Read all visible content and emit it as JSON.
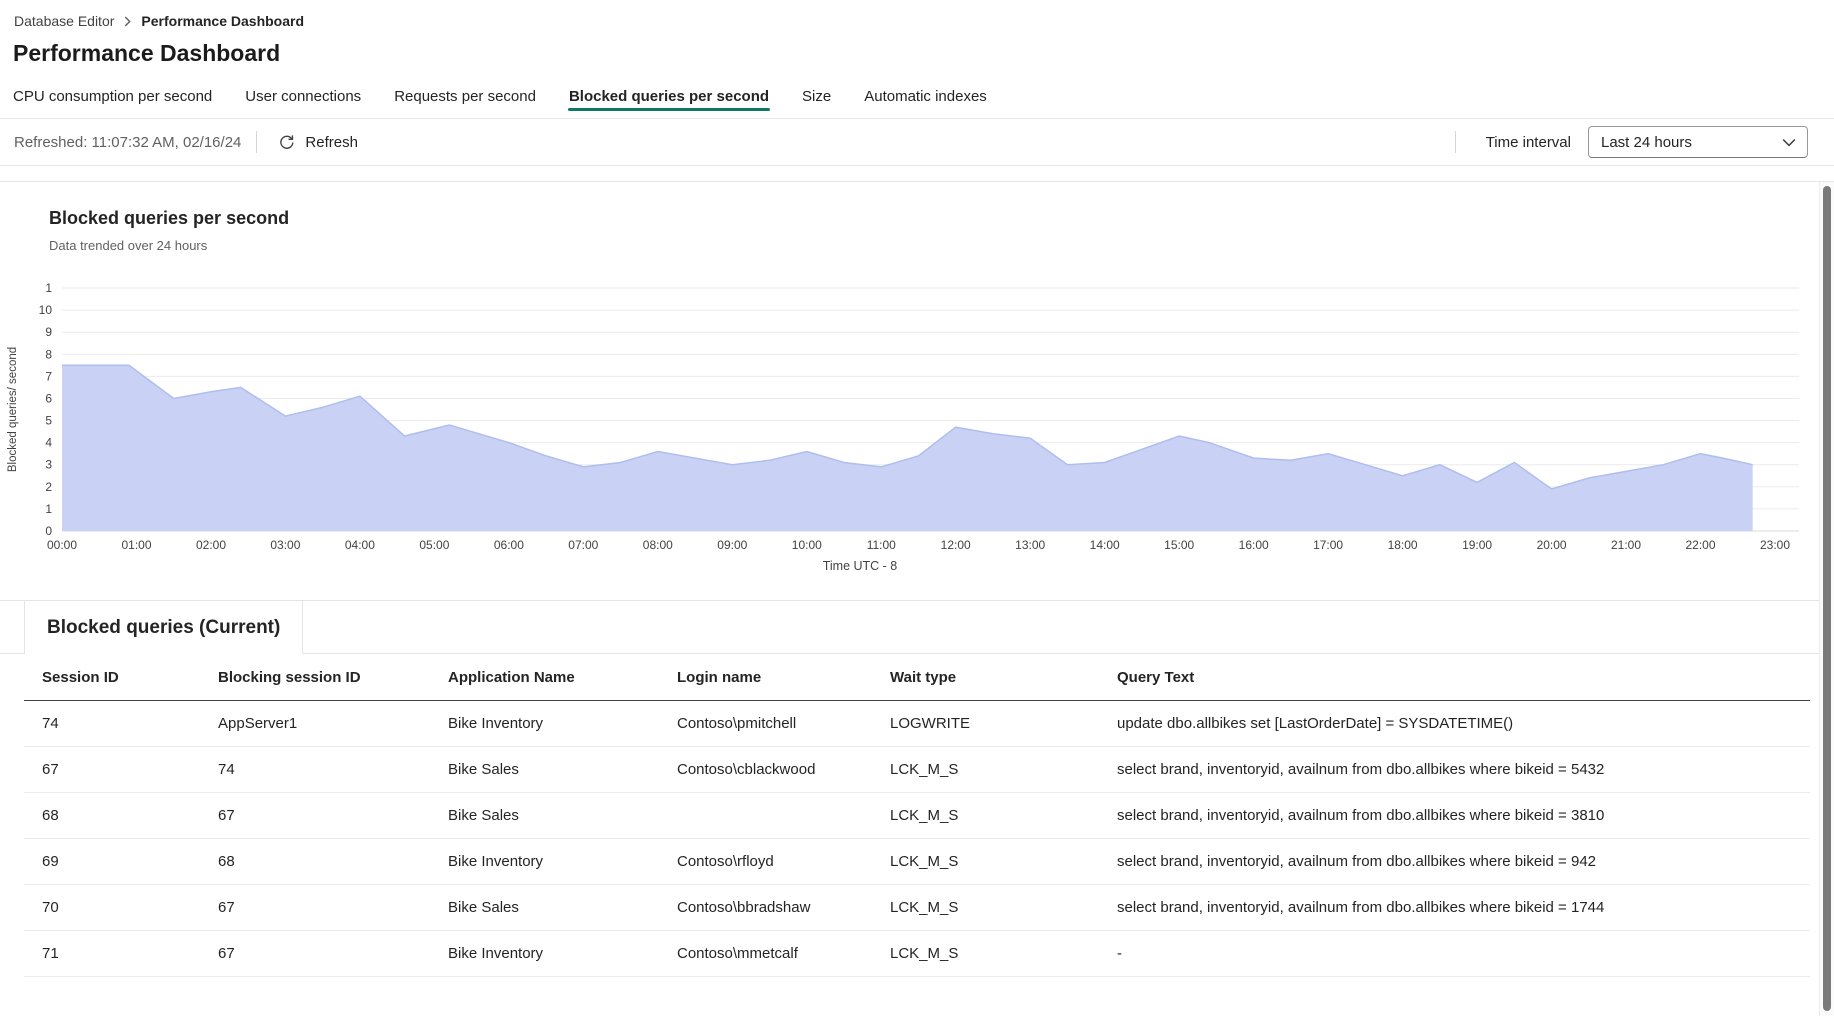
{
  "colors": {
    "accent": "#117865"
  },
  "breadcrumb": {
    "items": [
      "Database Editor",
      "Performance Dashboard"
    ]
  },
  "page": {
    "title": "Performance Dashboard"
  },
  "tabs": {
    "items": [
      {
        "label": "CPU consumption per second",
        "active": false
      },
      {
        "label": "User connections",
        "active": false
      },
      {
        "label": "Requests per second",
        "active": false
      },
      {
        "label": "Blocked queries per second",
        "active": true
      },
      {
        "label": "Size",
        "active": false
      },
      {
        "label": "Automatic indexes",
        "active": false
      }
    ]
  },
  "toolbar": {
    "refreshed_text": "Refreshed: 11:07:32 AM, 02/16/24",
    "refresh_label": "Refresh",
    "time_interval_label": "Time interval",
    "time_interval_value": "Last 24 hours"
  },
  "chart_data": {
    "type": "area",
    "title": "Blocked queries per second",
    "subtitle": "Data trended over 24 hours",
    "ylabel": "Blocked queries/ second",
    "xlabel": "Time UTC - 8",
    "ylim": [
      0,
      11
    ],
    "grid": true,
    "fill_color": "#c9d2f4",
    "line_color": "#b0bdee",
    "y_tick_labels": [
      "1",
      "10",
      "9",
      "8",
      "7",
      "6",
      "5",
      "4",
      "3",
      "2",
      "1",
      "0"
    ],
    "x_ticks": [
      "00:00",
      "01:00",
      "02:00",
      "03:00",
      "04:00",
      "05:00",
      "06:00",
      "07:00",
      "08:00",
      "09:00",
      "10:00",
      "11:00",
      "12:00",
      "13:00",
      "14:00",
      "15:00",
      "16:00",
      "17:00",
      "18:00",
      "19:00",
      "20:00",
      "21:00",
      "22:00",
      "23:00"
    ],
    "points": [
      [
        0,
        7.5
      ],
      [
        0.9,
        7.5
      ],
      [
        1.5,
        6.0
      ],
      [
        2.0,
        6.3
      ],
      [
        2.4,
        6.5
      ],
      [
        3.0,
        5.2
      ],
      [
        3.5,
        5.6
      ],
      [
        4.0,
        6.1
      ],
      [
        4.6,
        4.3
      ],
      [
        5.2,
        4.8
      ],
      [
        5.6,
        4.4
      ],
      [
        6.0,
        4.0
      ],
      [
        6.5,
        3.4
      ],
      [
        7.0,
        2.9
      ],
      [
        7.5,
        3.1
      ],
      [
        8.0,
        3.6
      ],
      [
        8.5,
        3.3
      ],
      [
        9.0,
        3.0
      ],
      [
        9.5,
        3.2
      ],
      [
        10.0,
        3.6
      ],
      [
        10.5,
        3.1
      ],
      [
        11.0,
        2.9
      ],
      [
        11.5,
        3.4
      ],
      [
        12.0,
        4.7
      ],
      [
        12.5,
        4.4
      ],
      [
        13.0,
        4.2
      ],
      [
        13.5,
        3.0
      ],
      [
        14.0,
        3.1
      ],
      [
        14.5,
        3.7
      ],
      [
        15.0,
        4.3
      ],
      [
        15.4,
        4.0
      ],
      [
        16.0,
        3.3
      ],
      [
        16.5,
        3.2
      ],
      [
        17.0,
        3.5
      ],
      [
        17.5,
        3.0
      ],
      [
        18.0,
        2.5
      ],
      [
        18.5,
        3.0
      ],
      [
        19.0,
        2.2
      ],
      [
        19.5,
        3.1
      ],
      [
        20.0,
        1.9
      ],
      [
        20.5,
        2.4
      ],
      [
        21.0,
        2.7
      ],
      [
        21.5,
        3.0
      ],
      [
        22.0,
        3.5
      ],
      [
        22.3,
        3.3
      ],
      [
        22.7,
        3.0
      ]
    ]
  },
  "table": {
    "section_title": "Blocked queries (Current)",
    "columns": [
      "Session ID",
      "Blocking session ID",
      "Application Name",
      "Login name",
      "Wait type",
      "Query Text"
    ],
    "rows": [
      [
        "74",
        "AppServer1",
        "Bike Inventory",
        "Contoso\\pmitchell",
        "LOGWRITE",
        "update  dbo.allbikes  set [LastOrderDate] = SYSDATETIME()"
      ],
      [
        "67",
        "74",
        "Bike Sales",
        "Contoso\\cblackwood",
        "LCK_M_S",
        "select brand, inventoryid, availnum  from dbo.allbikes where bikeid = 5432"
      ],
      [
        "68",
        "67",
        "Bike Sales",
        "",
        "LCK_M_S",
        "select brand, inventoryid, availnum  from dbo.allbikes where bikeid = 3810"
      ],
      [
        "69",
        "68",
        "Bike Inventory",
        "Contoso\\rfloyd",
        "LCK_M_S",
        "select brand, inventoryid, availnum  from dbo.allbikes where bikeid = 942"
      ],
      [
        "70",
        "67",
        "Bike Sales",
        "Contoso\\bbradshaw",
        "LCK_M_S",
        "select brand, inventoryid, availnum  from dbo.allbikes where bikeid = 1744"
      ],
      [
        "71",
        "67",
        "Bike Inventory",
        "Contoso\\mmetcalf",
        "LCK_M_S",
        "-"
      ]
    ]
  }
}
